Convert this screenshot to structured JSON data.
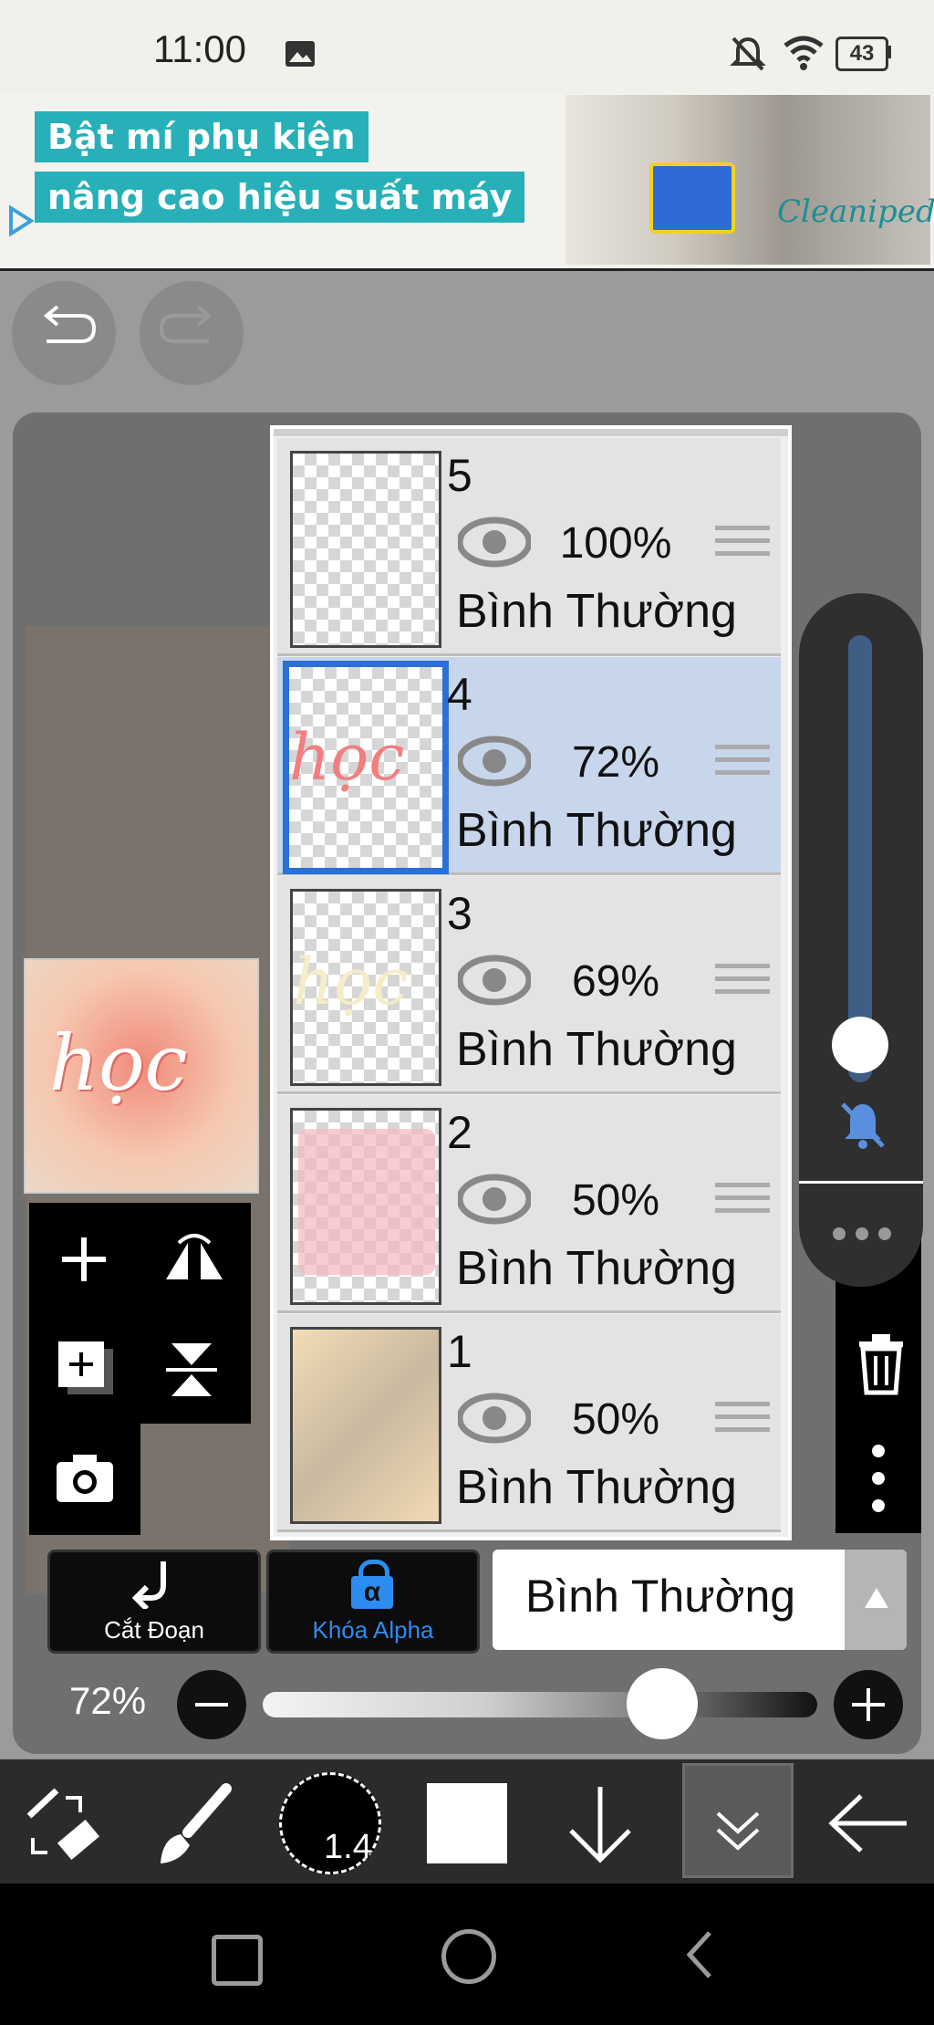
{
  "status_bar": {
    "time": "11:00",
    "battery": "43",
    "icons": [
      "image-icon",
      "bell-off-icon",
      "wifi-icon",
      "battery-icon"
    ]
  },
  "ad": {
    "line1": "Bật mí phụ kiện",
    "line2": "nâng cao hiệu suất máy",
    "brand": "Cleanipedia"
  },
  "history": {
    "undo_icon": "undo-icon",
    "redo_icon": "redo-icon"
  },
  "preview": {
    "text": "học"
  },
  "layers": [
    {
      "number": "5",
      "opacity": "100%",
      "mode": "Bình Thường",
      "selected": false,
      "thumb_text": ""
    },
    {
      "number": "4",
      "opacity": "72%",
      "mode": "Bình Thường",
      "selected": true,
      "thumb_text": "học"
    },
    {
      "number": "3",
      "opacity": "69%",
      "mode": "Bình Thường",
      "selected": false,
      "thumb_text": "học"
    },
    {
      "number": "2",
      "opacity": "50%",
      "mode": "Bình Thường",
      "selected": false,
      "thumb_text": ""
    },
    {
      "number": "1",
      "opacity": "50%",
      "mode": "Bình Thường",
      "selected": false,
      "thumb_text": ""
    }
  ],
  "layer_tools": {
    "icons": [
      "add-layer-icon",
      "flip-horizontal-icon",
      "duplicate-layer-icon",
      "flip-vertical-icon",
      "camera-icon",
      "trash-icon",
      "more-vertical-icon"
    ]
  },
  "bottom_controls": {
    "clip_label": "Cắt Đoạn",
    "alpha_lock_label": "Khóa Alpha",
    "alpha_symbol": "α",
    "blend_mode": "Bình Thường",
    "opacity_value": "72%",
    "opacity_fraction": 0.72
  },
  "toolbar": {
    "brush_size": "1.4",
    "icons": [
      "transform-eraser-icon",
      "brush-icon",
      "brush-size-indicator",
      "color-swatch",
      "move-down-icon",
      "collapse-icon",
      "back-arrow-icon"
    ]
  },
  "colors": {
    "selection_blue": "#2b6fd8",
    "ad_teal": "#27b0b8",
    "alpha_blue": "#2d8cf0"
  }
}
